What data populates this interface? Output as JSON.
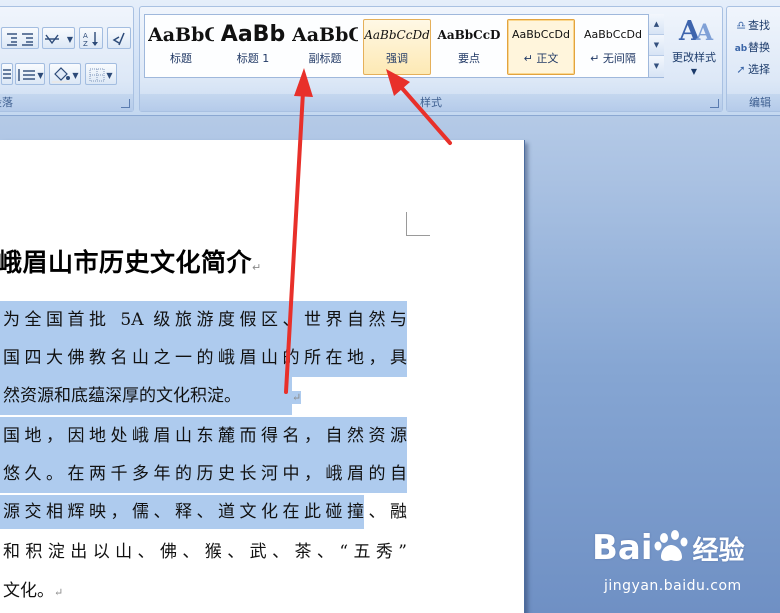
{
  "ribbon": {
    "paragraph_group_label": "段落",
    "styles_group_label": "样式",
    "editing_group_label": "编辑",
    "styles": [
      {
        "sample": "AaBbC",
        "name": "标题",
        "font": "serif-bold"
      },
      {
        "sample": "AaBb",
        "name": "标题 1",
        "font": "sans-bold-large"
      },
      {
        "sample": "AaBbC",
        "name": "副标题",
        "font": "serif-bold"
      },
      {
        "sample": "AaBbCcDd",
        "name": "强调",
        "font": "serif-italic"
      },
      {
        "sample": "AaBbCcD",
        "name": "要点",
        "font": "serif-bold-small"
      },
      {
        "sample": "AaBbCcDd",
        "name": "↵ 正文",
        "font": "sans-small"
      },
      {
        "sample": "AaBbCcDd",
        "name": "↵ 无间隔",
        "font": "sans-small"
      }
    ],
    "change_styles_label": "更改样式",
    "editing": {
      "find": "查找",
      "replace": "替换",
      "select": "选择"
    }
  },
  "document": {
    "title": "峨眉山市历史文化简介",
    "paragraph_mark": "↵",
    "lines": [
      "为全国首批 5A 级旅游度假区、世界自然与",
      "国四大佛教名山之一的峨眉山的所在地，具",
      "然资源和底蕴深厚的文化积淀。",
      "国地，因地处峨眉山东麓而得名，自然资源",
      "悠久。在两千多年的历史长河中，峨眉的自",
      "源交相辉映，儒、释、道文化在此碰撞、融",
      "和积淀出以山、佛、猴、武、茶、“五秀”",
      "文化。"
    ]
  },
  "watermark": {
    "logo_text": "Bai",
    "logo_suffix": "经验",
    "url": "jingyan.baidu.com"
  },
  "colors": {
    "highlight": "#aecbee",
    "arrow": "#e8302a",
    "ribbon_bg": "#dde8f7"
  }
}
